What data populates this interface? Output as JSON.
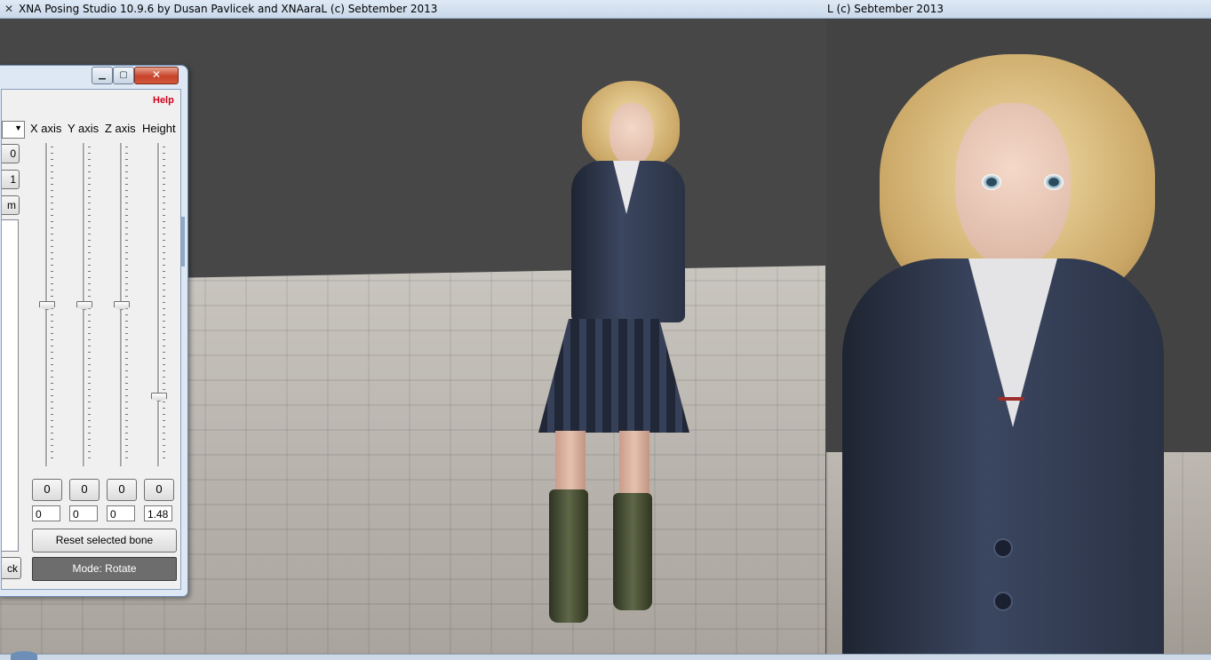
{
  "windows": {
    "left_title": "XNA Posing Studio 10.9.6 by Dusan Pavlicek and XNAaraL (c) Sebtember 2013",
    "right_title": "L (c) Sebtember 2013"
  },
  "toolbox": {
    "title_buttons": {
      "minimize": "▁",
      "maximize": "▢",
      "close": "✕"
    },
    "help_label": "Help",
    "columns": [
      "X axis",
      "Y axis",
      "Z axis",
      "Height"
    ],
    "cut_buttons": [
      "0",
      "1",
      "m"
    ],
    "sliders": [
      {
        "name": "x-axis",
        "position": 0.5
      },
      {
        "name": "y-axis",
        "position": 0.5
      },
      {
        "name": "z-axis",
        "position": 0.5
      },
      {
        "name": "height",
        "position": 0.79
      }
    ],
    "value_buttons": [
      "0",
      "0",
      "0",
      "0"
    ],
    "value_inputs": [
      "0",
      "0",
      "0",
      "1.48"
    ],
    "reset_label": "Reset selected bone",
    "mode_label": "Mode: Rotate",
    "back_cut_label": "ck"
  },
  "colors": {
    "titlebar": "#c9d8ea",
    "viewport_bg": "#474747",
    "help_red": "#d0021b",
    "mode_button": "#6d6d6d"
  },
  "icons": {
    "app_icon": "x-icon",
    "dropdown": "chevron-down-icon"
  }
}
